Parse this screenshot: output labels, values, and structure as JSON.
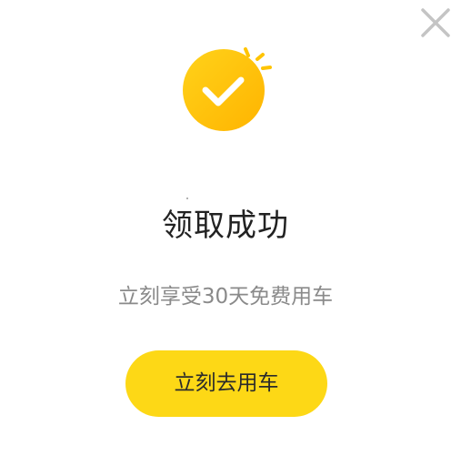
{
  "dialog": {
    "title": "领取成功",
    "subtitle": "立刻享受30天免费用车",
    "cta_label": "立刻去用车",
    "close_icon": "close-icon",
    "success_icon": "check-circle-icon"
  },
  "colors": {
    "accent": "#fdd816",
    "icon_gradient_start": "#ffd21a",
    "icon_gradient_end": "#ffb800",
    "title": "#222222",
    "subtitle": "#8a8a8a",
    "close": "#c4c4c4"
  }
}
